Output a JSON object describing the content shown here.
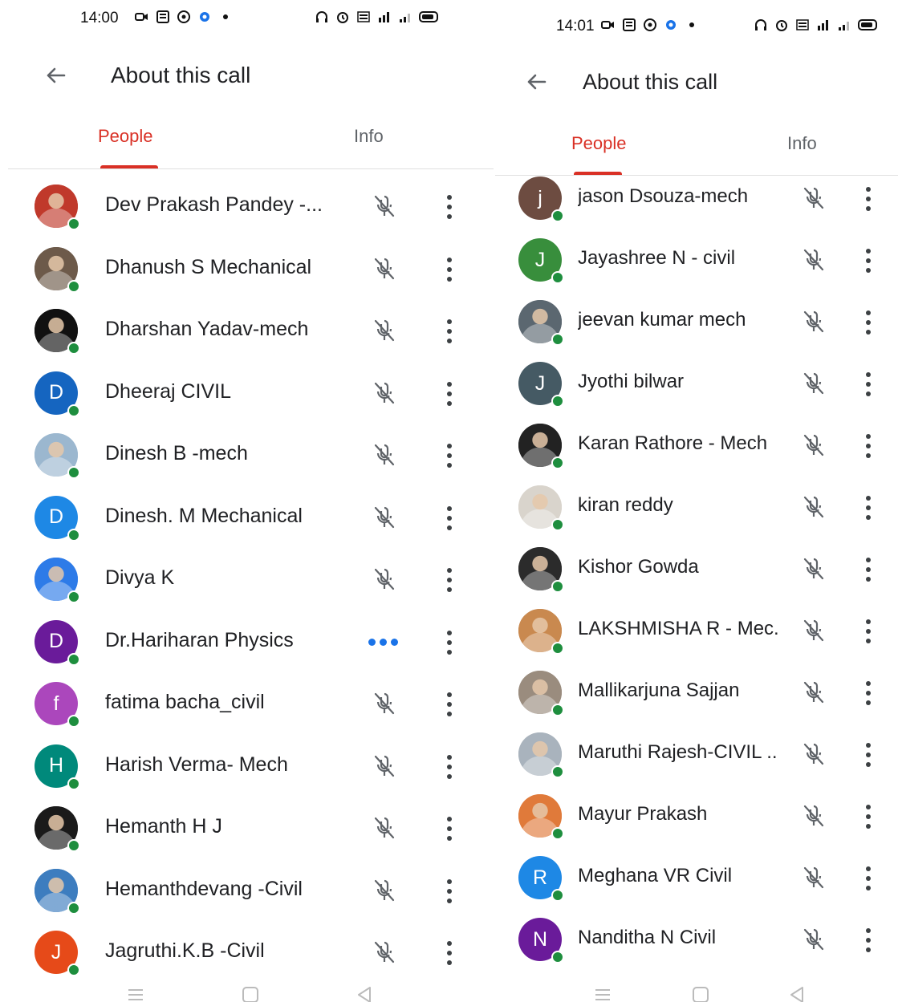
{
  "left": {
    "status": {
      "time": "14:00"
    },
    "title": "About this call",
    "tabs": [
      "People",
      "Info"
    ],
    "participants": [
      {
        "name": "Dev Prakash Pandey -...",
        "avatar": "photo",
        "color": "#c0392b",
        "state": "muted"
      },
      {
        "name": "Dhanush S Mechanical",
        "avatar": "photo",
        "color": "#6d5a4a",
        "state": "muted"
      },
      {
        "name": "Dharshan Yadav-mech",
        "avatar": "photo",
        "color": "#111111",
        "state": "muted"
      },
      {
        "name": "Dheeraj CIVIL",
        "avatar": "D",
        "color": "#1565c0",
        "state": "muted"
      },
      {
        "name": "Dinesh B -mech",
        "avatar": "photo",
        "color": "#9bb7cf",
        "state": "muted"
      },
      {
        "name": "Dinesh. M Mechanical",
        "avatar": "D",
        "color": "#1e88e5",
        "state": "muted"
      },
      {
        "name": "Divya K",
        "avatar": "photo",
        "color": "#2d7be8",
        "state": "muted"
      },
      {
        "name": "Dr.Hariharan Physics",
        "avatar": "D",
        "color": "#6a1b9a",
        "state": "speaking"
      },
      {
        "name": "fatima bacha_civil",
        "avatar": "f",
        "color": "#ab47bc",
        "state": "muted"
      },
      {
        "name": "Harish Verma- Mech",
        "avatar": "H",
        "color": "#00897b",
        "state": "muted"
      },
      {
        "name": "Hemanth H J",
        "avatar": "photo",
        "color": "#1a1a1a",
        "state": "muted"
      },
      {
        "name": "Hemanthdevang -Civil",
        "avatar": "photo",
        "color": "#3d7dbf",
        "state": "muted"
      },
      {
        "name": "Jagruthi.K.B -Civil",
        "avatar": "J",
        "color": "#e64a19",
        "state": "muted"
      }
    ]
  },
  "right": {
    "status": {
      "time": "14:01"
    },
    "title": "About this call",
    "tabs": [
      "People",
      "Info"
    ],
    "participants": [
      {
        "name": "jason Dsouza-mech",
        "avatar": "j",
        "color": "#6d4c41",
        "state": "muted"
      },
      {
        "name": "Jayashree N - civil",
        "avatar": "J",
        "color": "#388e3c",
        "state": "muted"
      },
      {
        "name": "jeevan kumar mech",
        "avatar": "photo",
        "color": "#5b6770",
        "state": "muted"
      },
      {
        "name": "Jyothi bilwar",
        "avatar": "J",
        "color": "#455a64",
        "state": "muted"
      },
      {
        "name": "Karan Rathore - Mech",
        "avatar": "photo",
        "color": "#222222",
        "state": "muted"
      },
      {
        "name": "kiran reddy",
        "avatar": "photo",
        "color": "#d9d4cc",
        "state": "muted"
      },
      {
        "name": "Kishor Gowda",
        "avatar": "photo",
        "color": "#2b2b2b",
        "state": "muted"
      },
      {
        "name": "LAKSHMISHA R - Mec...",
        "avatar": "photo",
        "color": "#c9894f",
        "state": "muted"
      },
      {
        "name": "Mallikarjuna Sajjan",
        "avatar": "photo",
        "color": "#9a8c7e",
        "state": "muted"
      },
      {
        "name": "Maruthi Rajesh-CIVIL ...",
        "avatar": "photo",
        "color": "#a9b3bd",
        "state": "muted"
      },
      {
        "name": "Mayur Prakash",
        "avatar": "photo",
        "color": "#e07a3a",
        "state": "muted"
      },
      {
        "name": "Meghana VR Civil",
        "avatar": "R",
        "color": "#1e88e5",
        "state": "muted"
      },
      {
        "name": "Nanditha N Civil",
        "avatar": "N",
        "color": "#6a1b9a",
        "state": "muted"
      }
    ]
  },
  "colors": {
    "accent": "#d93025",
    "online": "#1e8e3e",
    "speaking": "#1a73e8"
  },
  "icons": [
    "back-arrow-icon",
    "mic-off-icon",
    "more-vert-icon",
    "menu-icon",
    "home-icon",
    "back-icon"
  ]
}
